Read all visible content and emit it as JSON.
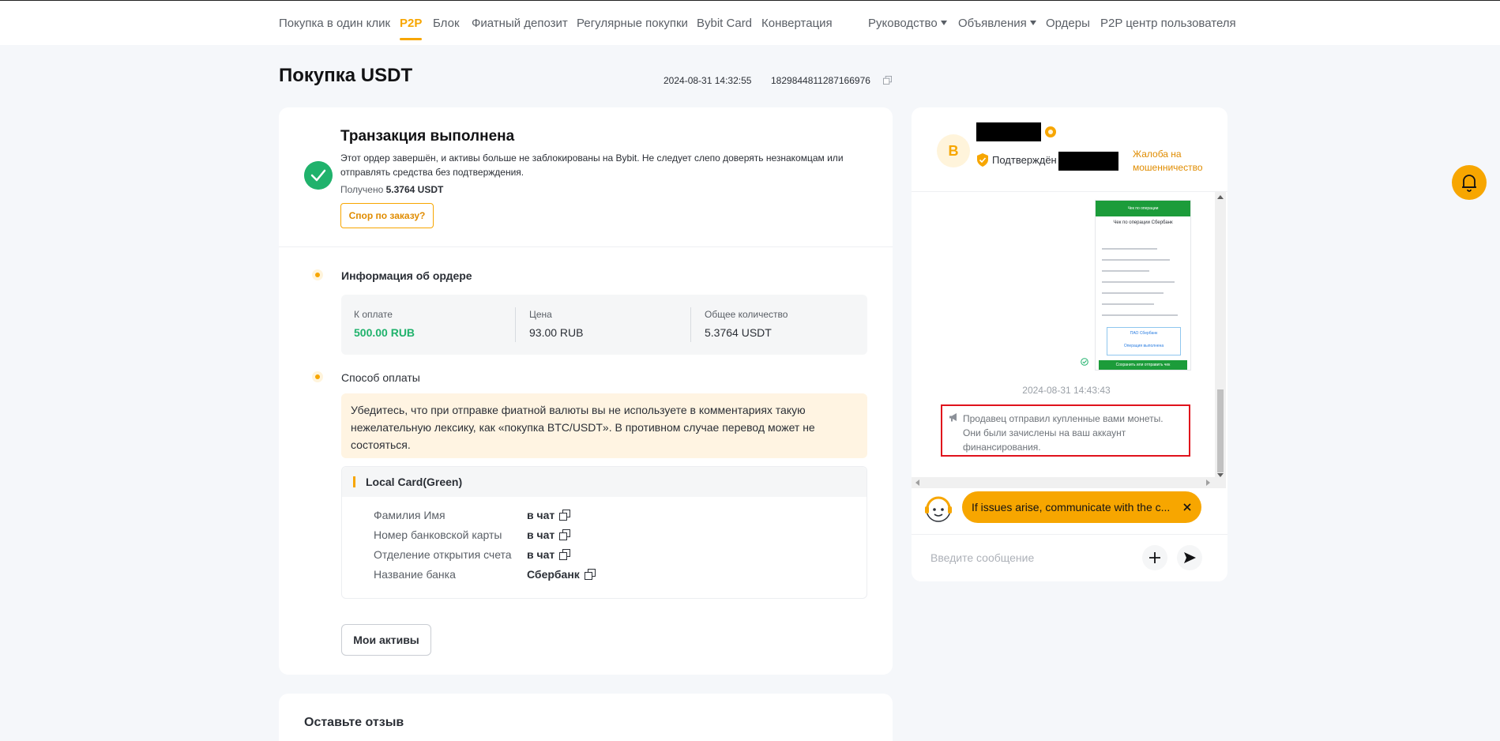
{
  "nav": {
    "items": [
      {
        "label": "Покупка в один клик"
      },
      {
        "label": "P2P",
        "active": true
      },
      {
        "label": "Блок"
      },
      {
        "label": "Фиатный депозит"
      },
      {
        "label": "Регулярные покупки"
      },
      {
        "label": "Bybit Card"
      },
      {
        "label": "Конвертация"
      },
      {
        "label": "Руководство",
        "dropdown": true
      },
      {
        "label": "Объявления",
        "dropdown": true
      },
      {
        "label": "Ордеры"
      },
      {
        "label": "P2P центр пользователя"
      }
    ]
  },
  "page": {
    "title": "Покупка USDT",
    "timestamp": "2024-08-31 14:32:55",
    "order_id": "1829844811287166976"
  },
  "status": {
    "title": "Транзакция выполнена",
    "description": "Этот ордер завершён, и активы больше не заблокированы на Bybit. Не следует слепо доверять незнакомцам или отправлять средства без подтверждения.",
    "received_label": "Получено",
    "received_value": "5.3764 USDT",
    "dispute_button": "Спор по заказу?"
  },
  "order_info": {
    "title": "Информация об ордере",
    "to_pay_label": "К оплате",
    "to_pay_value": "500.00 RUB",
    "price_label": "Цена",
    "price_value": "93.00 RUB",
    "total_label": "Общее количество",
    "total_value": "5.3764 USDT"
  },
  "payment": {
    "title": "Способ оплаты",
    "warning": "Убедитесь, что при отправке фиатной валюты вы не используете в комментариях такую нежелательную лексику, как «покупка BTC/USDT». В противном случае перевод может не состояться.",
    "method_name": "Local Card(Green)",
    "rows": [
      {
        "label": "Фамилия Имя",
        "value": "в чат"
      },
      {
        "label": "Номер банковской карты",
        "value": "в чат"
      },
      {
        "label": "Отделение открытия счета",
        "value": "в чат"
      },
      {
        "label": "Название банка",
        "value": "Сбербанк"
      }
    ]
  },
  "assets_button": "Мои активы",
  "review": {
    "title": "Оставьте отзыв"
  },
  "chat": {
    "avatar_letter": "B",
    "verified_label": "Подтверждён :",
    "complaint_link": "Жалоба на мошенничество",
    "receipt": {
      "header": "Чек по операции",
      "title": "Чек по операции Сбербанк",
      "box_line1": "ПАО Сбербанк",
      "box_line2": "Операция выполнена",
      "button": "Сохранить или отправить чек"
    },
    "message_time": "2024-08-31 14:43:43",
    "system_message": "Продавец отправил купленные вами монеты. Они были зачислены на ваш аккаунт финансирования.",
    "hint": "If issues arise, communicate with the c...",
    "input_placeholder": "Введите сообщение"
  },
  "colors": {
    "accent": "#f7a600",
    "success": "#20b26c",
    "alert_border": "#e0121c"
  }
}
